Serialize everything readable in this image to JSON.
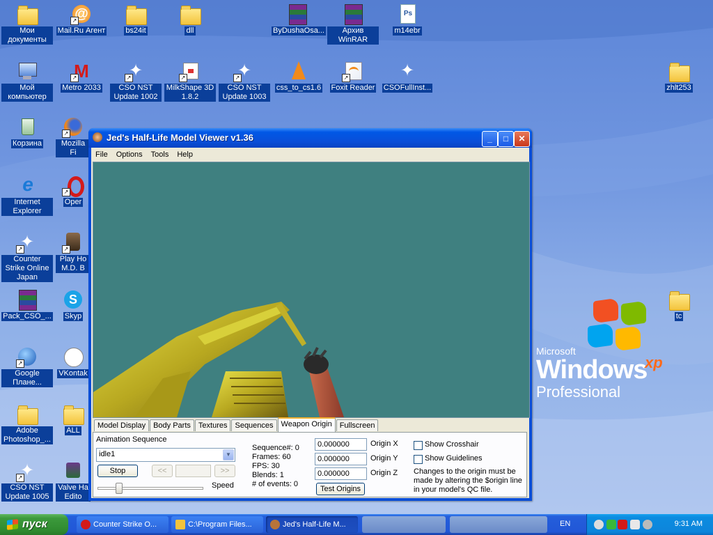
{
  "desktop": {
    "icons": [
      {
        "label": "Мои документы",
        "type": "folder"
      },
      {
        "label": "Mail.Ru Агент",
        "type": "mailru"
      },
      {
        "label": "bs24it",
        "type": "folder"
      },
      {
        "label": "dll",
        "type": "folder"
      },
      {
        "label": "ByDushaOsa...",
        "type": "winrar"
      },
      {
        "label": "Архив WinRAR",
        "type": "winrar"
      },
      {
        "label": "m14ebr",
        "type": "ps"
      },
      {
        "label": "Мой компьютер",
        "type": "computer"
      },
      {
        "label": "Metro 2033",
        "type": "metro"
      },
      {
        "label": "CSO NST Update 1002",
        "type": "soldier"
      },
      {
        "label": "MilkShape 3D 1.8.2",
        "type": "milkshape"
      },
      {
        "label": "CSO NST Update 1003",
        "type": "soldier"
      },
      {
        "label": "css_to_cs1.6",
        "type": "vlc"
      },
      {
        "label": "Foxit Reader",
        "type": "foxit"
      },
      {
        "label": "CSOFullInst...",
        "type": "soldier"
      },
      {
        "label": "zhlt253",
        "type": "folder"
      },
      {
        "label": "Корзина",
        "type": "recycle"
      },
      {
        "label": "Mozilla Fi",
        "type": "firefox"
      },
      {
        "label": "Internet Explorer",
        "type": "ie"
      },
      {
        "label": "Oper",
        "type": "opera"
      },
      {
        "label": "Counter Strike Online Japan",
        "type": "soldier"
      },
      {
        "label": "Play Ho M.D. B",
        "type": "house"
      },
      {
        "label": "Pack_CSO_...",
        "type": "winrar"
      },
      {
        "label": "Skyp",
        "type": "skype"
      },
      {
        "label": "tc",
        "type": "folder"
      },
      {
        "label": "Google Плане...",
        "type": "earth"
      },
      {
        "label": "VKontak",
        "type": "vk"
      },
      {
        "label": "Adobe Photoshop_...",
        "type": "folder"
      },
      {
        "label": "ALL",
        "type": "folder"
      },
      {
        "label": "CSO NST Update 1005",
        "type": "soldier"
      },
      {
        "label": "Valve Ha Edito",
        "type": "valve"
      }
    ],
    "wallpaper": {
      "brand_small": "Microsoft",
      "brand_big": "Windows",
      "brand_xp": "xp",
      "edition": "Professional"
    }
  },
  "window": {
    "title": "Jed's Half-Life Model Viewer v1.36",
    "controls": {
      "minimize": "_",
      "maximize": "□",
      "close": "✕"
    },
    "menu": [
      "File",
      "Options",
      "Tools",
      "Help"
    ],
    "viewport_bg": "#3f8080",
    "tabs": [
      "Model Display",
      "Body Parts",
      "Textures",
      "Sequences",
      "Weapon Origin",
      "Fullscreen"
    ],
    "active_tab": "Weapon Origin",
    "panel": {
      "anim_label": "Animation Sequence",
      "anim_value": "idle1",
      "stop_label": "Stop",
      "prev_label": "<<",
      "next_label": ">>",
      "speed_label": "Speed",
      "speed_level": 0.2,
      "info": {
        "sequence": "Sequence#: 0",
        "frames": "Frames: 60",
        "fps": "FPS: 30",
        "blends": "Blends: 1",
        "events": "# of events: 0"
      },
      "origin_x_value": "0.000000",
      "origin_y_value": "0.000000",
      "origin_z_value": "0.000000",
      "origin_x_label": "Origin X",
      "origin_y_label": "Origin Y",
      "origin_z_label": "Origin Z",
      "test_origins_label": "Test Origins",
      "show_crosshair_label": "Show Crosshair",
      "show_guidelines_label": "Show Guidelines",
      "note": "Changes to the origin must be made by altering the $origin line in your model's QC file."
    }
  },
  "taskbar": {
    "start_label": "пуск",
    "tasks": [
      {
        "label": "Counter Strike O...",
        "color": "#d41a1a"
      },
      {
        "label": "C:\\Program Files...",
        "color": "#f3c33c"
      },
      {
        "label": "Jed's Half-Life M...",
        "color": "#b8743a"
      }
    ],
    "language": "EN",
    "clock": "9:31 AM"
  }
}
